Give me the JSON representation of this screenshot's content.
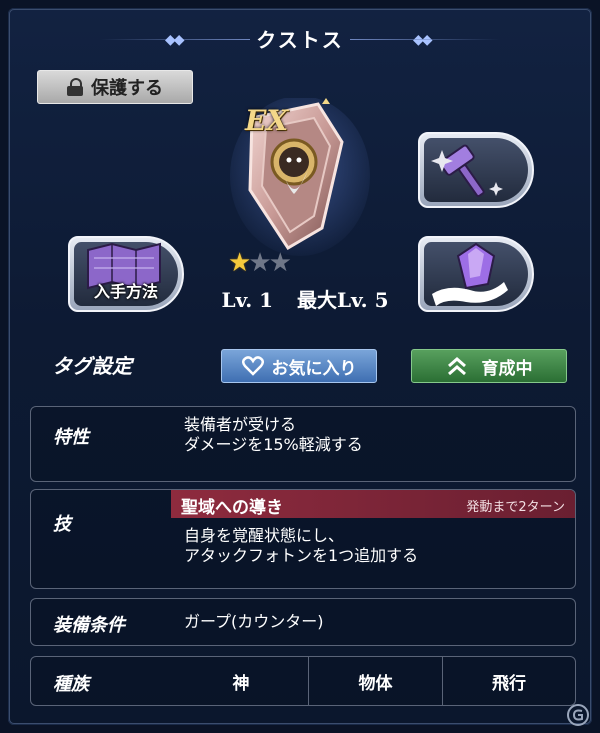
{
  "title": "クストス",
  "protect_button": {
    "label": "保護する",
    "icon": "lock-icon"
  },
  "equipment": {
    "rank": "EX",
    "stars_filled": 1,
    "stars_total": 3,
    "level_text": "Lv. 1",
    "max_level_text": "最大Lv. 5"
  },
  "side_buttons": {
    "forge": {
      "icon": "hammer-sparkle-icon"
    },
    "obtain": {
      "label": "入手方法",
      "icon": "map-icon"
    },
    "crystal": {
      "icon": "crystal-hand-icon"
    }
  },
  "tags": {
    "label": "タグ設定",
    "favorite": "お気に入り",
    "training": "育成中"
  },
  "trait": {
    "label": "特性",
    "line1": "装備者が受ける",
    "line2": "ダメージを15%軽減する"
  },
  "skill": {
    "label": "技",
    "name": "聖域への導き",
    "turns": "発動まで2ターン",
    "line1": "自身を覚醒状態にし、",
    "line2": "アタックフォトンを1つ追加する"
  },
  "equip_condition": {
    "label": "装備条件",
    "value": "ガープ(カウンター)"
  },
  "race": {
    "label": "種族",
    "values": [
      "神",
      "物体",
      "飛行"
    ]
  },
  "colors": {
    "background": "#0d1a33",
    "skill_bar": "#8e2b3e",
    "favorite_button": "#4f7fc0",
    "training_button": "#3a8442",
    "star_on": "#f4c93c"
  }
}
